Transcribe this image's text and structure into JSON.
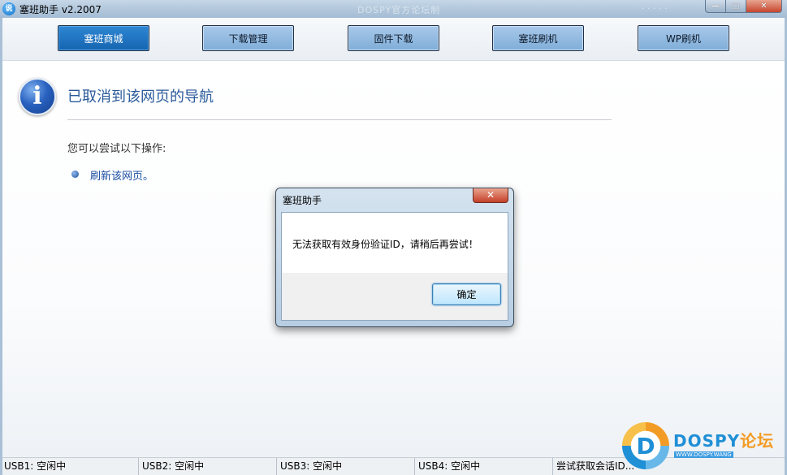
{
  "window": {
    "title": "塞班助手 v2.2007",
    "icon_text": "说",
    "watermark_text": "DOSPY官方论坛制",
    "watermark_right": "· · · · ·"
  },
  "window_controls": {
    "minimize_glyph": "—",
    "maximize_glyph": "□",
    "close_glyph": "✕"
  },
  "tabs": [
    {
      "label": "塞班商城",
      "active": true
    },
    {
      "label": "下载管理",
      "active": false
    },
    {
      "label": "固件下载",
      "active": false
    },
    {
      "label": "塞班刷机",
      "active": false
    },
    {
      "label": "WP刷机",
      "active": false
    }
  ],
  "page": {
    "icon_glyph": "i",
    "title": "已取消到该网页的导航",
    "subtitle": "您可以尝试以下操作:",
    "refresh_link": "刷新该网页。"
  },
  "dialog": {
    "title": "塞班助手",
    "close_glyph": "✕",
    "message": "无法获取有效身份验证ID，请稍后再尝试！",
    "ok_label": "确定"
  },
  "statusbar": [
    "USB1: 空闲中",
    "USB2: 空闲中",
    "USB3: 空闲中",
    "USB4: 空闲中",
    "尝试获取会话ID..."
  ],
  "branding": {
    "logo_letter": "D",
    "name_main": "DOSPY",
    "name_accent": "论坛",
    "sub": "WWW.DOSPY.WANG"
  }
}
